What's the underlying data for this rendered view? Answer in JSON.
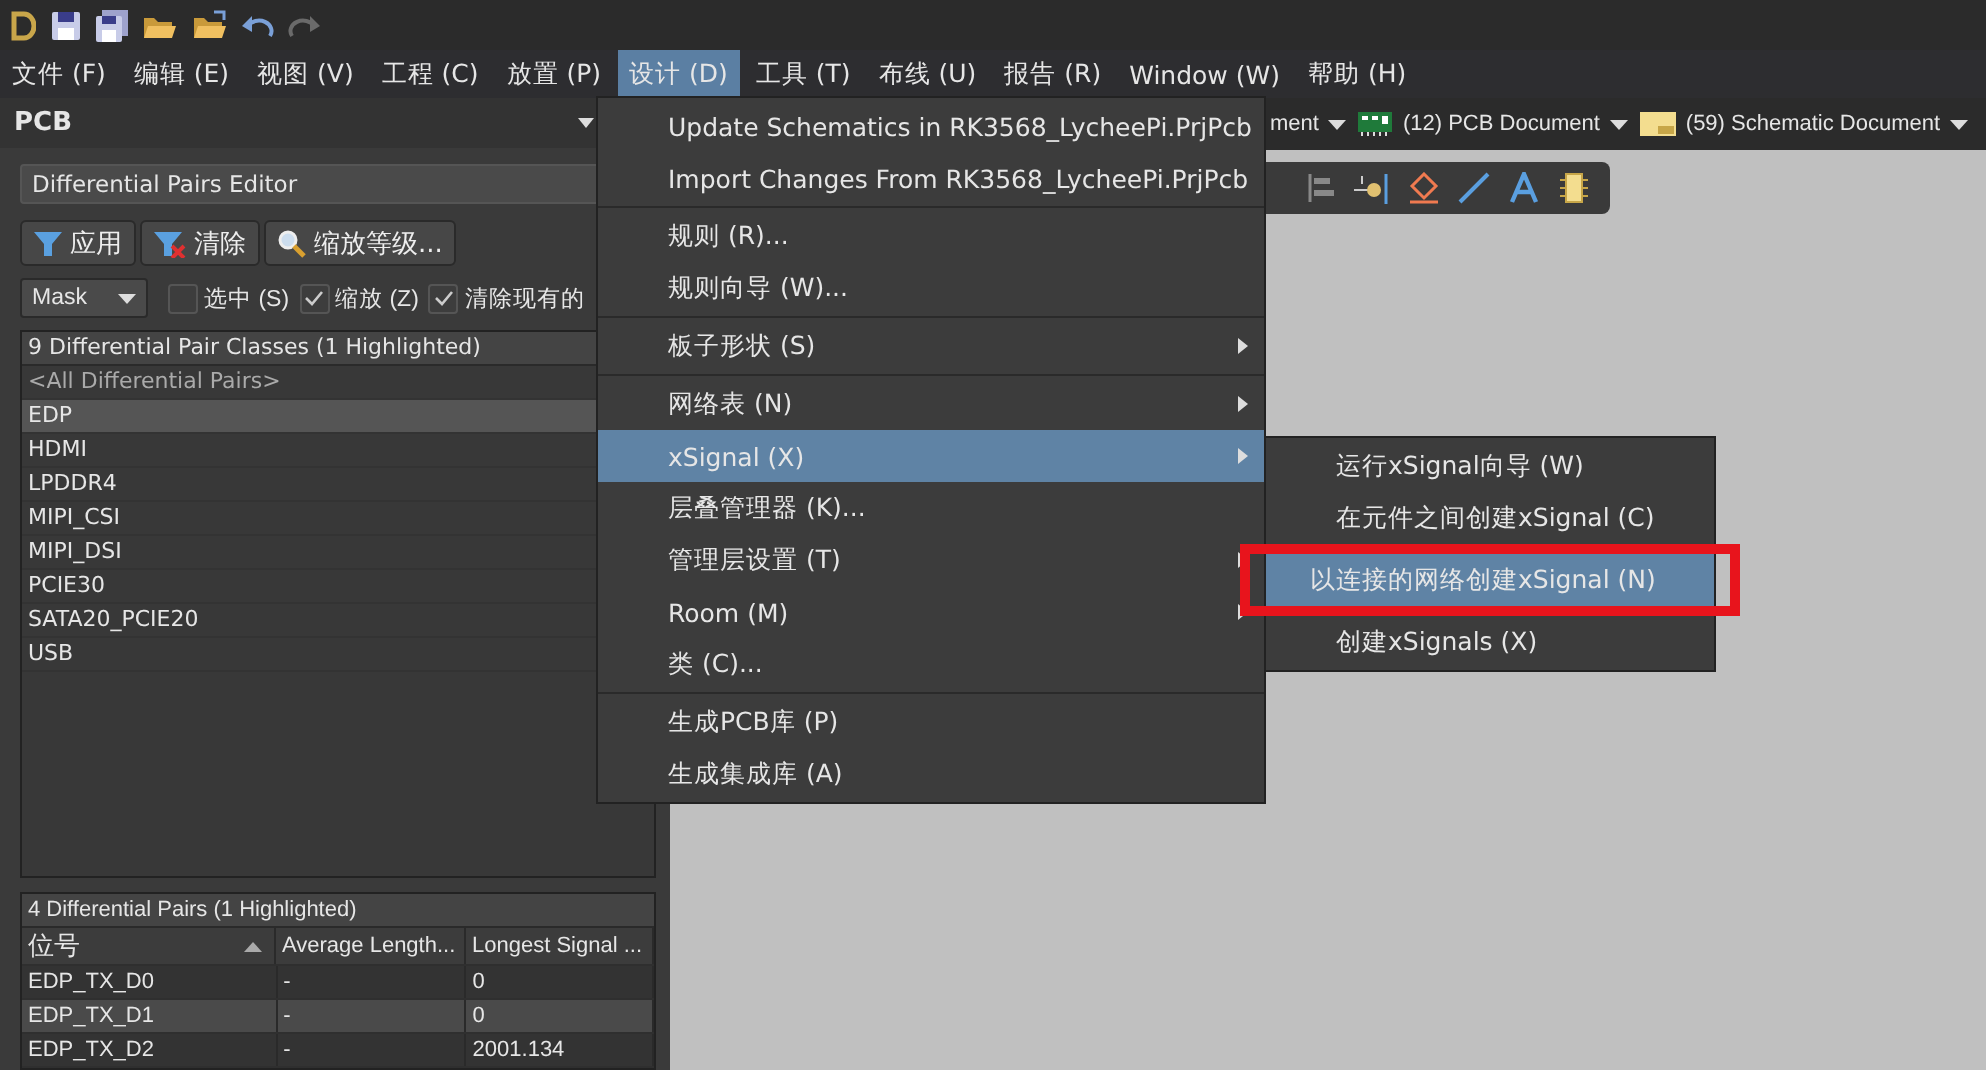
{
  "menubar": [
    {
      "label": "文件 (F)",
      "selected": false
    },
    {
      "label": "编辑 (E)",
      "selected": false
    },
    {
      "label": "视图 (V)",
      "selected": false
    },
    {
      "label": "工程 (C)",
      "selected": false
    },
    {
      "label": "放置 (P)",
      "selected": false
    },
    {
      "label": "设计 (D)",
      "selected": true
    },
    {
      "label": "工具 (T)",
      "selected": false
    },
    {
      "label": "布线 (U)",
      "selected": false
    },
    {
      "label": "报告 (R)",
      "selected": false
    },
    {
      "label": "Window (W)",
      "selected": false
    },
    {
      "label": "帮助 (H)",
      "selected": false
    }
  ],
  "panel": {
    "title": "PCB",
    "mode": "Differential Pairs Editor",
    "buttons": [
      {
        "kind": "apply",
        "label": "应用"
      },
      {
        "kind": "clear",
        "label": "清除"
      },
      {
        "kind": "zoom",
        "label": "缩放等级..."
      }
    ],
    "mask": "Mask",
    "options": [
      {
        "label": "选中 (S)",
        "checked": false
      },
      {
        "label": "缩放 (Z)",
        "checked": true
      },
      {
        "label": "清除现有的",
        "checked": true
      }
    ],
    "classes_header": "9 Differential Pair Classes (1 Highlighted)",
    "classes": [
      {
        "label": "<All Differential Pairs>",
        "kind": "all",
        "selected": false
      },
      {
        "label": "EDP",
        "kind": "class",
        "selected": true
      },
      {
        "label": "HDMI",
        "kind": "class",
        "selected": false
      },
      {
        "label": "LPDDR4",
        "kind": "class",
        "selected": false
      },
      {
        "label": "MIPI_CSI",
        "kind": "class",
        "selected": false
      },
      {
        "label": "MIPI_DSI",
        "kind": "class",
        "selected": false
      },
      {
        "label": "PCIE30",
        "kind": "class",
        "selected": false
      },
      {
        "label": "SATA20_PCIE20",
        "kind": "class",
        "selected": false
      },
      {
        "label": "USB",
        "kind": "class",
        "selected": false
      }
    ],
    "pairs_header": "4 Differential Pairs (1 Highlighted)",
    "columns": [
      "位号",
      "Average Length...",
      "Longest Signal ..."
    ],
    "rows": [
      {
        "cells": [
          "EDP_TX_D0",
          "-",
          "0"
        ],
        "selected": false
      },
      {
        "cells": [
          "EDP_TX_D1",
          "-",
          "0"
        ],
        "selected": true
      },
      {
        "cells": [
          "EDP_TX_D2",
          "-",
          "2001.134"
        ],
        "selected": false
      }
    ]
  },
  "doc_tabs": [
    {
      "kind": "generic",
      "label": "ment"
    },
    {
      "kind": "pcb",
      "label": "(12) PCB Document"
    },
    {
      "kind": "schematic",
      "label": "(59) Schematic Document"
    }
  ],
  "design_menu": [
    [
      {
        "label": "Update Schematics in RK3568_LycheePi.PrjPcb",
        "submenu": false,
        "selected": false
      },
      {
        "label": "Import Changes From RK3568_LycheePi.PrjPcb",
        "submenu": false,
        "selected": false
      }
    ],
    [
      {
        "label": "规则 (R)...",
        "submenu": false,
        "selected": false
      },
      {
        "label": "规则向导 (W)...",
        "submenu": false,
        "selected": false
      }
    ],
    [
      {
        "label": "板子形状 (S)",
        "submenu": true,
        "selected": false
      }
    ],
    [
      {
        "label": "网络表 (N)",
        "submenu": true,
        "selected": false
      },
      {
        "label": "xSignal (X)",
        "submenu": true,
        "selected": true
      },
      {
        "label": "层叠管理器 (K)...",
        "submenu": false,
        "selected": false
      },
      {
        "label": "管理层设置 (T)",
        "submenu": true,
        "selected": false
      },
      {
        "label": "Room (M)",
        "submenu": true,
        "selected": false
      },
      {
        "label": "类 (C)...",
        "submenu": false,
        "selected": false
      }
    ],
    [
      {
        "label": "生成PCB库 (P)",
        "submenu": false,
        "selected": false
      },
      {
        "label": "生成集成库 (A)",
        "submenu": false,
        "selected": false
      }
    ]
  ],
  "xsignal_menu": [
    {
      "label": "运行xSignal向导 (W)",
      "selected": false
    },
    {
      "label": "在元件之间创建xSignal (C)",
      "selected": false
    },
    {
      "label": "以连接的网络创建xSignal (N)",
      "selected": true
    },
    {
      "label": "创建xSignals (X)",
      "selected": false
    }
  ]
}
